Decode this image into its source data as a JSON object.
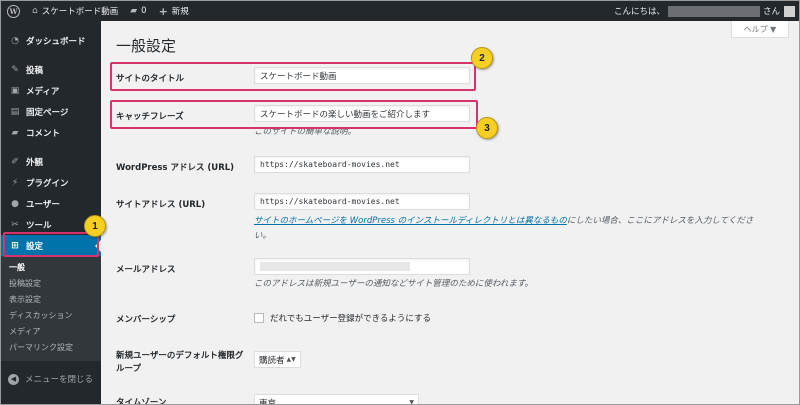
{
  "admin_bar": {
    "site_name": "スケートボード動画",
    "comments_count": "0",
    "new_label": "新規",
    "greeting": "こんにちは、",
    "user_suffix": "さん"
  },
  "sidebar": {
    "dashboard": "ダッシュボード",
    "items": [
      {
        "label": "投稿",
        "icon": "pin-icon"
      },
      {
        "label": "メディア",
        "icon": "media-icon"
      },
      {
        "label": "固定ページ",
        "icon": "page-icon"
      },
      {
        "label": "コメント",
        "icon": "comment-icon"
      },
      {
        "label": "外観",
        "icon": "brush-icon"
      },
      {
        "label": "プラグイン",
        "icon": "plugin-icon"
      },
      {
        "label": "ユーザー",
        "icon": "user-icon"
      },
      {
        "label": "ツール",
        "icon": "wrench-icon"
      },
      {
        "label": "設定",
        "icon": "settings-icon"
      }
    ],
    "submenu": [
      "一般",
      "投稿設定",
      "表示設定",
      "ディスカッション",
      "メディア",
      "パーマリンク設定"
    ],
    "collapse_label": "メニューを閉じる"
  },
  "main": {
    "help_label": "ヘルプ ▼",
    "page_title": "一般設定",
    "site_title_label": "サイトのタイトル",
    "site_title_value": "スケートボード動画",
    "tagline_label": "キャッチフレーズ",
    "tagline_value": "スケートボードの楽しい動画をご紹介します",
    "tagline_desc": "このサイトの簡単な説明。",
    "wp_address_label": "WordPress アドレス (URL)",
    "wp_address_value": "https://skateboard-movies.net",
    "site_address_label": "サイトアドレス (URL)",
    "site_address_value": "https://skateboard-movies.net",
    "site_address_link": "サイトのホームページを WordPress のインストールディレクトリとは異なるもの",
    "site_address_desc_rest": "にしたい場合、ここにアドレスを入力してくださ",
    "site_address_desc_line2": "い。",
    "email_label": "メールアドレス",
    "email_desc": "このアドレスは新規ユーザーの通知などサイト管理のために使われます。",
    "membership_label": "メンバーシップ",
    "membership_checkbox": "だれでもユーザー登録ができるようにする",
    "default_role_label": "新規ユーザーのデフォルト権限グループ",
    "default_role_value": "購読者",
    "timezone_label": "タイムゾーン",
    "timezone_value": "東京"
  },
  "annotations": {
    "badge1": "1",
    "badge2": "2",
    "badge3": "3"
  },
  "colors": {
    "accent": "#0073aa",
    "highlight": "#d6336c",
    "badge": "#f5d020",
    "sidebar": "#23282d"
  }
}
